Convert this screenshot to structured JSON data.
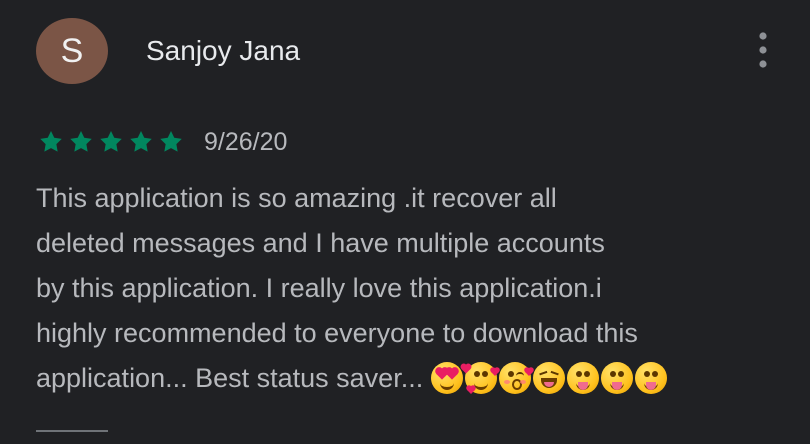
{
  "review": {
    "author": {
      "initial": "S",
      "name": "Sanjoy Jana",
      "avatar_color": "#7b5546"
    },
    "rating": {
      "value": 5,
      "max": 5,
      "star_color": "#01875f"
    },
    "date": "9/26/20",
    "text": "This application is so amazing .it recover all\ndeleted messages and I have multiple accounts\nby this application. I really love this application.i\nhighly recommended to everyone to download this\napplication... Best status saver...",
    "emojis": [
      "heart-eyes-emoji",
      "smiling-face-with-hearts-emoji",
      "face-blowing-kiss-emoji",
      "squinting-tongue-emoji",
      "face-with-tongue-emoji",
      "face-with-tongue-emoji",
      "face-with-tongue-emoji"
    ]
  },
  "actions": {
    "more_icon": "more-vert-icon"
  },
  "colors": {
    "background": "#202124",
    "name_text": "#e8eaed",
    "body_text": "#b7b9bd",
    "divider": "#6f7378"
  }
}
